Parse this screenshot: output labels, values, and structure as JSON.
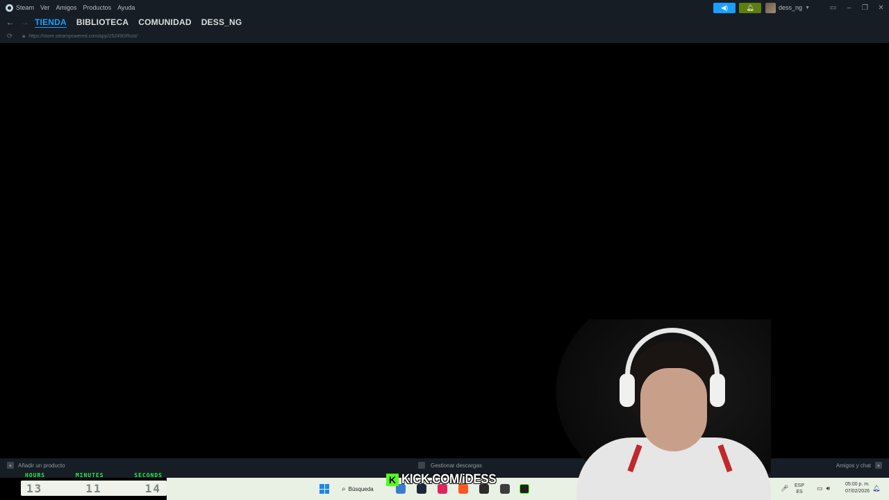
{
  "menubar": {
    "items": [
      "Steam",
      "Ver",
      "Amigos",
      "Productos",
      "Ayuda"
    ],
    "username": "dess_ng"
  },
  "nav": {
    "tabs": [
      "TIENDA",
      "BIBLIOTECA",
      "COMUNIDAD",
      "DESS_NG"
    ],
    "active_tab": "TIENDA",
    "url": "https://store.steampowered.com/app/252490/Rust/"
  },
  "bottombar": {
    "add_product": "Añadir un producto",
    "downloads": "Gestionar descargas",
    "friends_chat": "Amigos y chat"
  },
  "timer": {
    "labels": [
      "HOURS",
      "MINUTES",
      "SECONDS"
    ],
    "values": [
      "13",
      "11",
      "14"
    ]
  },
  "overlay": {
    "kick_text": "KICK.COM/iDESS"
  },
  "taskbar": {
    "search_label": "Búsqueda",
    "lang_top": "ESP",
    "lang_bottom": "ES",
    "time": "05:00 p. m.",
    "date": "07/02/2026"
  },
  "colors": {
    "steam_bg": "#171d25",
    "accent_blue": "#1a9fff",
    "notif_green": "#5c7e10",
    "timer_green": "#2ee84b",
    "kick_green": "#53fc18"
  }
}
